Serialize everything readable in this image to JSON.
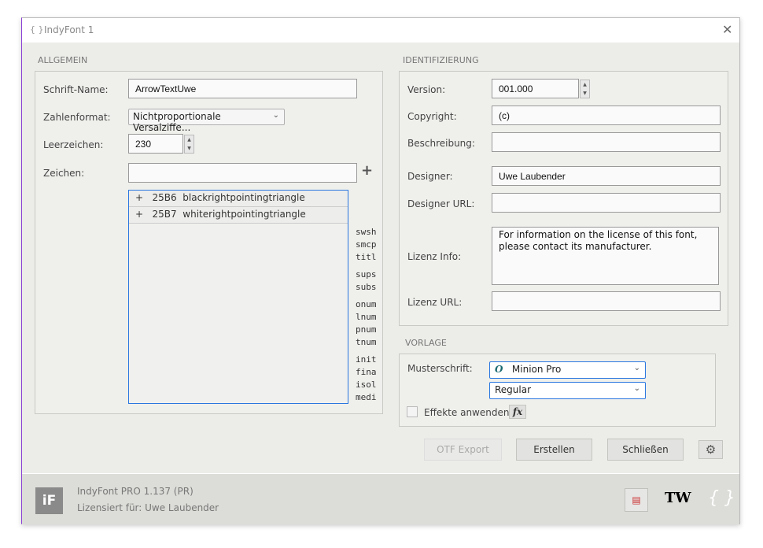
{
  "window": {
    "title": "IndyFont 1",
    "title_icon": "braces-icon",
    "close_icon": "close-icon"
  },
  "allgemein": {
    "heading": "ALLGEMEIN",
    "schrift_name": {
      "label": "Schrift-Name:",
      "value": "ArrowTextUwe"
    },
    "zahlenformat": {
      "label": "Zahlenformat:",
      "value": "Nichtproportionale Versalziffe..."
    },
    "leerzeichen": {
      "label": "Leerzeichen:",
      "value": "230"
    },
    "zeichen": {
      "label": "Zeichen:",
      "value": "",
      "add_icon": "plus-icon"
    },
    "glyphs": [
      {
        "expand": "+",
        "code": "25B6",
        "name": "blackrightpointingtriangle"
      },
      {
        "expand": "+",
        "code": "25B7",
        "name": "whiterightpointingtriangle"
      }
    ],
    "features": [
      "swsh",
      "smcp",
      "titl",
      "sups",
      "subs",
      "onum",
      "lnum",
      "pnum",
      "tnum",
      "init",
      "fina",
      "isol",
      "medi"
    ]
  },
  "identifizierung": {
    "heading": "IDENTIFIZIERUNG",
    "version": {
      "label": "Version:",
      "value": "001.000"
    },
    "copyright": {
      "label": "Copyright:",
      "value": "(c)"
    },
    "beschreibung": {
      "label": "Beschreibung:",
      "value": ""
    },
    "designer": {
      "label": "Designer:",
      "value": "Uwe Laubender"
    },
    "designer_url": {
      "label": "Designer URL:",
      "value": ""
    },
    "lizenz_info": {
      "label": "Lizenz Info:",
      "value": "For information on the license of this font, please contact its manufacturer."
    },
    "lizenz_url": {
      "label": "Lizenz URL:",
      "value": ""
    }
  },
  "vorlage": {
    "heading": "VORLAGE",
    "musterschrift_label": "Musterschrift:",
    "font": "Minion Pro",
    "font_icon": "opentype-icon",
    "style": "Regular",
    "effekte_label": "Effekte anwenden",
    "effekte_checked": false,
    "fx_label": "fx"
  },
  "buttons": {
    "otf_export": "OTF Export",
    "erstellen": "Erstellen",
    "schliessen": "Schließen",
    "settings_icon": "gear-icon"
  },
  "footer": {
    "logo": "iF",
    "product": "IndyFont PRO  1.137  (PR)",
    "license": "Lizensiert für: Uwe Laubender",
    "icons": [
      "document-icon",
      "tw-logo-icon",
      "braces-logo-icon"
    ]
  }
}
